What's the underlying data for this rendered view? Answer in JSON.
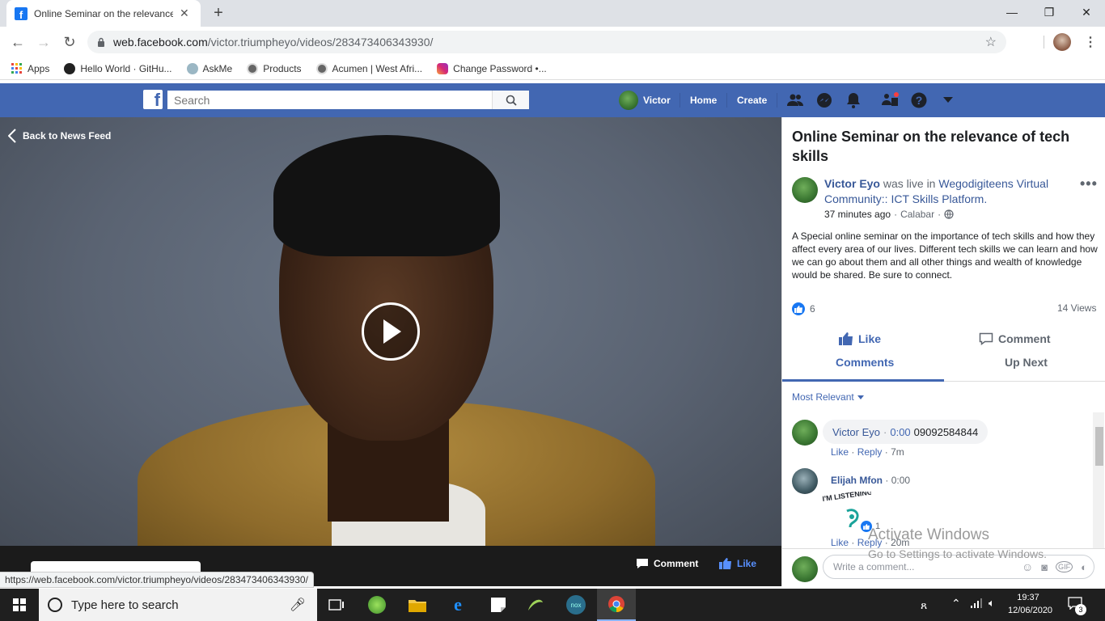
{
  "browser": {
    "tab_title": "Online Seminar on the relevance",
    "url_host": "web.facebook.com",
    "url_path": "/victor.triumpheyo/videos/283473406343930/",
    "bookmarks": [
      {
        "label": "Apps",
        "icon": "apps-grid-icon"
      },
      {
        "label": "Hello World · GitHu...",
        "icon": "github-icon"
      },
      {
        "label": "AskMe",
        "icon": "askme-icon"
      },
      {
        "label": "Products",
        "icon": "globe-icon"
      },
      {
        "label": "Acumen | West Afri...",
        "icon": "globe-icon"
      },
      {
        "label": "Change Password •...",
        "icon": "instagram-icon"
      }
    ],
    "status_url": "https://web.facebook.com/victor.triumpheyo/videos/283473406343930/"
  },
  "fb": {
    "search_placeholder": "Search",
    "user_name": "Victor",
    "nav_home": "Home",
    "nav_create": "Create",
    "brand_color": "#4267b2"
  },
  "video": {
    "back_label": "Back to News Feed",
    "comment_label": "Comment",
    "like_label": "Like"
  },
  "post": {
    "title": "Online Seminar on the relevance of tech skills",
    "author": "Victor Eyo",
    "was_live_in": "was live in",
    "community": "Wegodigiteens Virtual Community:: ICT Skills Platform.",
    "time": "37 minutes ago",
    "location": "Calabar",
    "description": "A Special online seminar on the importance of tech skills and how they affect every area of our lives. Different tech skills we can learn and how we can go about them and all other things and wealth of knowledge would be shared. Be sure to connect.",
    "like_count": "6",
    "views": "14 Views",
    "like_btn": "Like",
    "comment_btn": "Comment",
    "tab_comments": "Comments",
    "tab_upnext": "Up Next",
    "sort_label": "Most Relevant",
    "comments": [
      {
        "author": "Victor Eyo",
        "timestamp": "0:00",
        "text": "09092584844",
        "like": "Like",
        "reply": "Reply",
        "age": "7m"
      },
      {
        "author": "Elijah Mfon",
        "timestamp": "0:00",
        "sticker_text": "I'M LISTENING",
        "reactions": "1",
        "like": "Like",
        "reply": "Reply",
        "age": "20m"
      }
    ],
    "write_placeholder": "Write a comment..."
  },
  "watermark": {
    "line1": "Activate Windows",
    "line2": "Go to Settings to activate Windows."
  },
  "taskbar": {
    "search_placeholder": "Type here to search",
    "time": "19:37",
    "date": "12/06/2020",
    "notifications": "3"
  }
}
